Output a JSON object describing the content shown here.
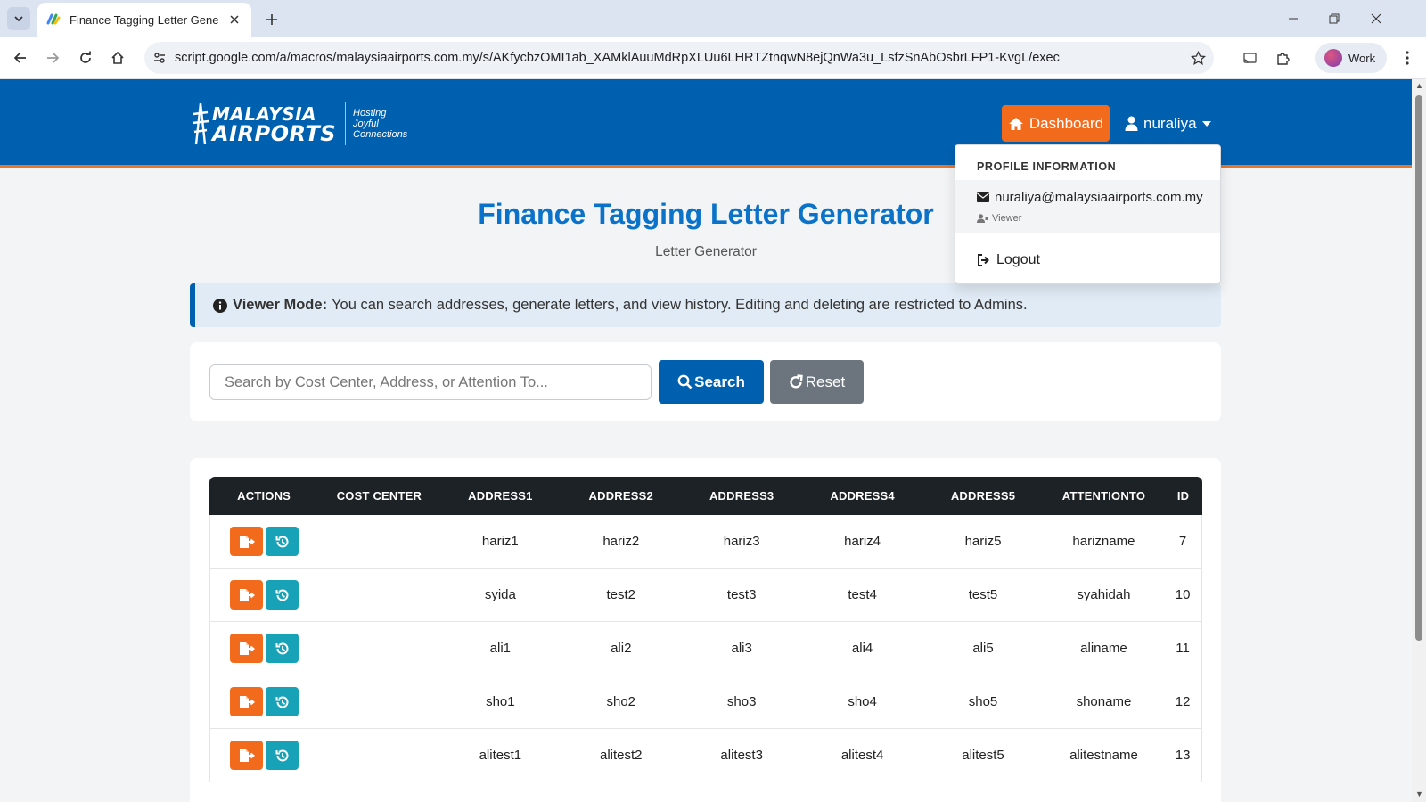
{
  "browser": {
    "tab_title": "Finance Tagging Letter Generator",
    "url": "script.google.com/a/macros/malaysiaairports.com.my/s/AKfycbzOMI1ab_XAMklAuuMdRpXLUu6LHRTZtnqwN8ejQnWa3u_LsfzSnAbOsbrLFP1-KvgL/exec",
    "profile_label": "Work"
  },
  "header": {
    "logo_line1": "MALAYSIA",
    "logo_line2": "AIRPORTS",
    "logo_tag1": "Hosting",
    "logo_tag2": "Joyful",
    "logo_tag3": "Connections",
    "dashboard_label": "Dashboard",
    "username": "nuraliya"
  },
  "dropdown": {
    "header": "PROFILE INFORMATION",
    "email": "nuraliya@malaysiaairports.com.my",
    "role": "Viewer",
    "logout_label": "Logout"
  },
  "page": {
    "title": "Finance Tagging Letter Generator",
    "subtitle": "Letter Generator"
  },
  "alert": {
    "strong": "Viewer Mode:",
    "text": "You can search addresses, generate letters, and view history. Editing and deleting are restricted to Admins."
  },
  "search": {
    "placeholder": "Search by Cost Center, Address, or Attention To...",
    "value": "",
    "search_label": "Search",
    "reset_label": "Reset"
  },
  "table": {
    "columns": [
      "ACTIONS",
      "COST CENTER",
      "ADDRESS1",
      "ADDRESS2",
      "ADDRESS3",
      "ADDRESS4",
      "ADDRESS5",
      "ATTENTIONTO",
      "ID"
    ],
    "rows": [
      {
        "cost_center": "",
        "address1": "hariz1",
        "address2": "hariz2",
        "address3": "hariz3",
        "address4": "hariz4",
        "address5": "hariz5",
        "attention_to": "harizname",
        "id": "7"
      },
      {
        "cost_center": "",
        "address1": "syida",
        "address2": "test2",
        "address3": "test3",
        "address4": "test4",
        "address5": "test5",
        "attention_to": "syahidah",
        "id": "10"
      },
      {
        "cost_center": "",
        "address1": "ali1",
        "address2": "ali2",
        "address3": "ali3",
        "address4": "ali4",
        "address5": "ali5",
        "attention_to": "aliname",
        "id": "11"
      },
      {
        "cost_center": "",
        "address1": "sho1",
        "address2": "sho2",
        "address3": "sho3",
        "address4": "sho4",
        "address5": "sho5",
        "attention_to": "shoname",
        "id": "12"
      },
      {
        "cost_center": "",
        "address1": "alitest1",
        "address2": "alitest2",
        "address3": "alitest3",
        "address4": "alitest4",
        "address5": "alitest5",
        "attention_to": "alitestname",
        "id": "13"
      }
    ]
  },
  "colors": {
    "header_blue": "#0060b0",
    "accent_orange": "#f26b1d",
    "history_teal": "#17a2b8",
    "title_blue": "#0b72c9"
  }
}
